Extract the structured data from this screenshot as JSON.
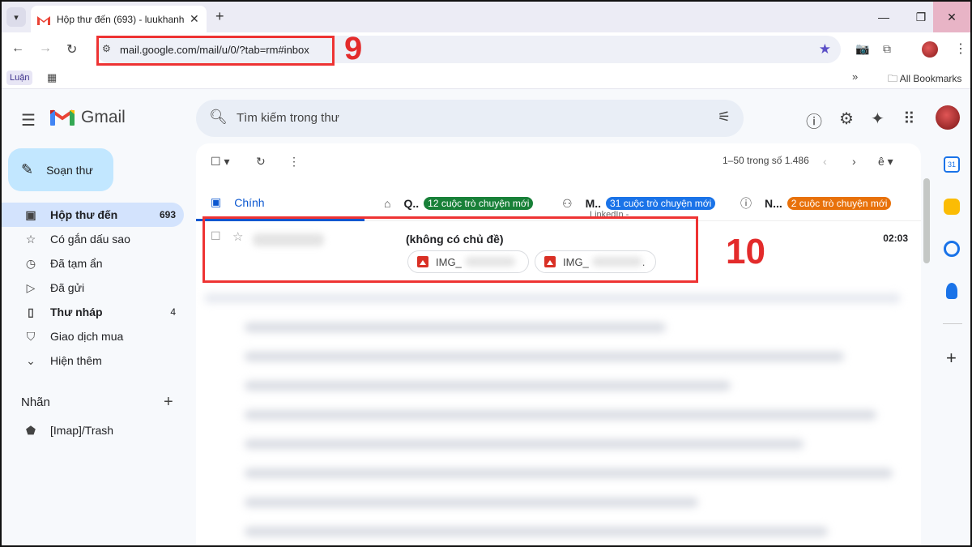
{
  "browser": {
    "tab_title": "Hộp thư đến (693) - luukhanh6",
    "tab_close": "✕",
    "new_tab": "+",
    "url": "mail.google.com/mail/u/0/?tab=rm#inbox",
    "bookmark_luan": "Luận",
    "bookmarks_more": "»",
    "all_bookmarks": "All Bookmarks"
  },
  "annotations": {
    "step_9": "9",
    "step_10": "10"
  },
  "gmail": {
    "logo_text": "Gmail",
    "search_placeholder": "Tìm kiếm trong thư",
    "compose_label": "Soạn thư"
  },
  "sidebar": {
    "items": [
      {
        "label": "Hộp thư đến",
        "count": "693",
        "icon": "inbox-icon"
      },
      {
        "label": "Có gắn dấu sao",
        "count": "",
        "icon": "star-icon"
      },
      {
        "label": "Đã tạm ẩn",
        "count": "",
        "icon": "clock-icon"
      },
      {
        "label": "Đã gửi",
        "count": "",
        "icon": "send-icon"
      },
      {
        "label": "Thư nháp",
        "count": "4",
        "icon": "draft-icon"
      },
      {
        "label": "Giao dịch mua",
        "count": "",
        "icon": "shopping-bag-icon"
      },
      {
        "label": "Hiện thêm",
        "count": "",
        "icon": "chevron-down-icon"
      }
    ],
    "labels_header": "Nhãn",
    "labels": [
      {
        "label": "[Imap]/Trash",
        "icon": "label-icon"
      }
    ]
  },
  "toolbar": {
    "pagination": "1–50 trong số 1.486"
  },
  "category_tabs": {
    "primary": "Chính",
    "promotions_initial": "Q..",
    "promotions_badge": "12 cuộc trò chuyện mới",
    "social_initial": "M..",
    "social_badge": "31 cuộc trò chuyện mới",
    "social_sub": "LinkedIn -",
    "updates_initial": "N...",
    "updates_badge": "2 cuộc trò chuyện mới"
  },
  "email_row": {
    "subject": "(không có chủ đề)",
    "time": "02:03",
    "attachments": [
      "IMG_",
      "IMG_"
    ],
    "attachment_2_suffix": "."
  },
  "colors": {
    "accent": "#0b57d0",
    "promotions_badge": "#188038",
    "social_badge": "#1a73e8",
    "updates_badge": "#e8710a",
    "annotation_red": "#e32b2b"
  }
}
